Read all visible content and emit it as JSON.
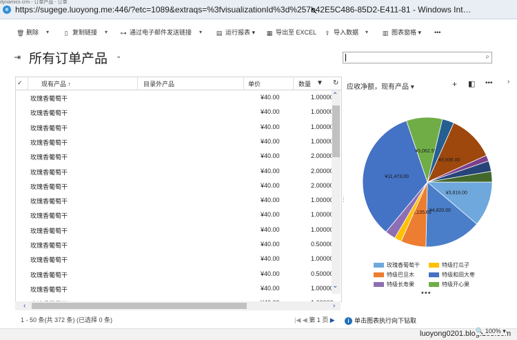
{
  "window": {
    "tab_strip_text": "dynamics crm - 订单产品 - 订单",
    "title": "https://sugege.luoyong.me:446/?etc=1089&extraqs=%3fvisualizationId%3d%257b42E5C486-85D2-E411-81 - Windows Int…"
  },
  "toolbar": {
    "delete": "删除",
    "copy_link": "复制链接",
    "email_link": "通过电子邮件发送链接",
    "run_report": "运行报表",
    "export_excel": "导出至 EXCEL",
    "import_data": "导入数据",
    "chart_pane": "图表窗格",
    "more": "•••"
  },
  "view": {
    "title": "所有订单产品"
  },
  "search": {
    "value": "",
    "placeholder": ""
  },
  "grid": {
    "columns": [
      "现有产品 ↑",
      "目录外产品",
      "单价",
      "数量"
    ],
    "rows": [
      {
        "product": "玫瑰香葡萄干",
        "price": "¥40.00",
        "qty": "1.00000"
      },
      {
        "product": "玫瑰香葡萄干",
        "price": "¥40.00",
        "qty": "1.00000"
      },
      {
        "product": "玫瑰香葡萄干",
        "price": "¥40.00",
        "qty": "1.00000"
      },
      {
        "product": "玫瑰香葡萄干",
        "price": "¥40.00",
        "qty": "1.00000"
      },
      {
        "product": "玫瑰香葡萄干",
        "price": "¥40.00",
        "qty": "2.00000"
      },
      {
        "product": "玫瑰香葡萄干",
        "price": "¥40.00",
        "qty": "2.00000"
      },
      {
        "product": "玫瑰香葡萄干",
        "price": "¥40.00",
        "qty": "2.00000"
      },
      {
        "product": "玫瑰香葡萄干",
        "price": "¥40.00",
        "qty": "1.00000"
      },
      {
        "product": "玫瑰香葡萄干",
        "price": "¥40.00",
        "qty": "1.00000"
      },
      {
        "product": "玫瑰香葡萄干",
        "price": "¥40.00",
        "qty": "1.00000"
      },
      {
        "product": "玫瑰香葡萄干",
        "price": "¥40.00",
        "qty": "0.50000"
      },
      {
        "product": "玫瑰香葡萄干",
        "price": "¥40.00",
        "qty": "1.00000"
      },
      {
        "product": "玫瑰香葡萄干",
        "price": "¥40.00",
        "qty": "0.50000"
      },
      {
        "product": "玫瑰香葡萄干",
        "price": "¥40.00",
        "qty": "1.00000"
      },
      {
        "product": "玫瑰香葡萄干",
        "price": "¥40.00",
        "qty": "1.00000"
      }
    ],
    "status": "1 - 50 条(共 372 条) (已选择 0 条)",
    "page": "第 1 页"
  },
  "chart": {
    "header": "应收净额，现有产品",
    "footer_info": "单击图表执行向下钻取"
  },
  "chart_data": {
    "type": "pie",
    "title": "应收净额，现有产品",
    "slices": [
      {
        "label": "¥3,816.00",
        "value": 3816,
        "color": "#6fa8dc"
      },
      {
        "label": "¥4,820.00",
        "value": 4820,
        "color": "#4a7ec9"
      },
      {
        "label": "¥2,135.60",
        "value": 2135.6,
        "color": "#ed7d31"
      },
      {
        "label": "",
        "value": 600,
        "color": "#ffc000"
      },
      {
        "label": "",
        "value": 900,
        "color": "#8e6fb3"
      },
      {
        "label": "¥11,473.00",
        "value": 11473,
        "color": "#4472c4"
      },
      {
        "label": "¥3,062.55",
        "value": 3062.55,
        "color": "#70ad47"
      },
      {
        "label": "",
        "value": 1000,
        "color": "#255e91"
      },
      {
        "label": "¥3,936.00",
        "value": 3936,
        "color": "#9e480e"
      },
      {
        "label": "",
        "value": 500,
        "color": "#7b3f8c"
      },
      {
        "label": "",
        "value": 900,
        "color": "#264478"
      },
      {
        "label": "",
        "value": 900,
        "color": "#43682b"
      }
    ],
    "legend": [
      {
        "name": "玫瑰香葡萄干",
        "color": "#6fa8dc"
      },
      {
        "name": "特级打瓜子",
        "color": "#ffc000"
      },
      {
        "name": "特级巴旦木",
        "color": "#ed7d31"
      },
      {
        "name": "特级和田大枣",
        "color": "#4472c4"
      },
      {
        "name": "特级长寿果",
        "color": "#8e6fb3"
      },
      {
        "name": "特级开心果",
        "color": "#70ad47"
      }
    ]
  },
  "statusbar": {
    "zoom": "100%",
    "watermark": "luoyong0201.blog.163.com"
  }
}
